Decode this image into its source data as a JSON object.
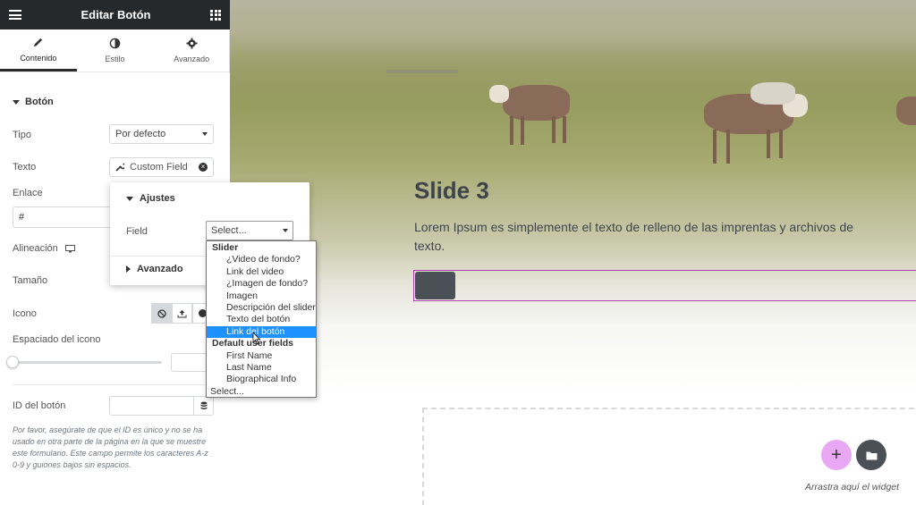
{
  "panel": {
    "title": "Editar Botón",
    "tabs": [
      {
        "label": "Contenido",
        "icon": "pencil-icon"
      },
      {
        "label": "Estilo",
        "icon": "contrast-icon"
      },
      {
        "label": "Avanzado",
        "icon": "gear-icon"
      }
    ],
    "section": "Botón",
    "controls": {
      "tipo_label": "Tipo",
      "tipo_value": "Por defecto",
      "texto_label": "Texto",
      "texto_value": "Custom Field",
      "enlace_label": "Enlace",
      "enlace_value": "#",
      "alineacion_label": "Alineación",
      "tamano_label": "Tamaño",
      "icono_label": "Icono",
      "espaciado_label": "Espaciado del icono",
      "id_label": "ID del botón",
      "help_text": "Por favor, asegúrate de que el ID es único y no se ha usado en otra parte de la página en la que se muestre este formulario. Este campo permite los caracteres A-z 0-9 y guiones bajos sin espacios."
    }
  },
  "popover": {
    "ajustes_label": "Ajustes",
    "field_label": "Field",
    "field_value": "Select...",
    "avanzado_label": "Avanzado"
  },
  "dropdown": {
    "groups": [
      {
        "label": "Slider",
        "options": [
          "¿Video de fondo?",
          "Link del video",
          "¿Imagen de fondo?",
          "Imagen",
          "Descripción del slider",
          "Texto del botón",
          "Link del botón"
        ]
      },
      {
        "label": "Default user fields",
        "options": [
          "First Name",
          "Last Name",
          "Biographical Info"
        ]
      }
    ],
    "highlighted": "Link del botón",
    "last_option": "Select..."
  },
  "canvas": {
    "slide_title": "Slide 3",
    "slide_text": "Lorem Ipsum es simplemente el texto de relleno de las imprentas y archivos de texto.",
    "drag_hint": "Arrastra aquí el widget",
    "add_icon": "plus-icon",
    "template_icon": "folder-icon"
  }
}
